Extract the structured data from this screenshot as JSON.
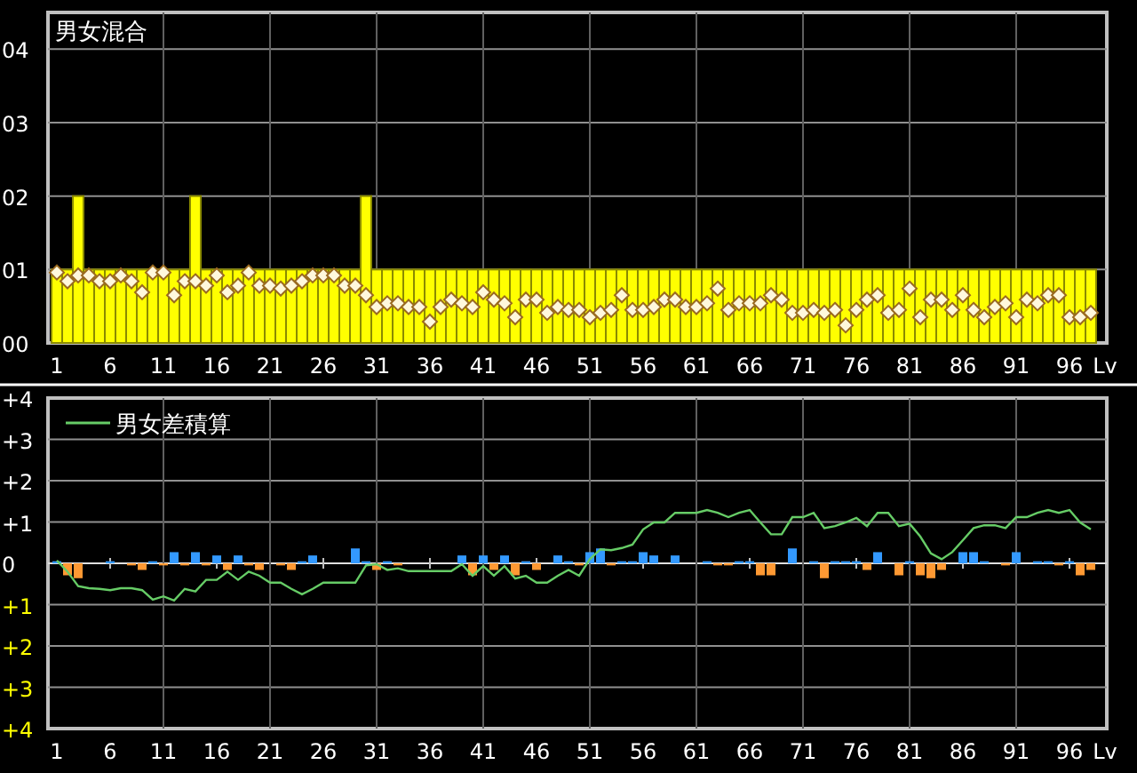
{
  "charts": [
    {
      "chart_data": {
        "type": "bar",
        "title": "男女混合",
        "xlabel": "Lv",
        "grid": true,
        "x": [
          1,
          2,
          3,
          4,
          5,
          6,
          7,
          8,
          9,
          10,
          11,
          12,
          13,
          14,
          15,
          16,
          17,
          18,
          19,
          20,
          21,
          22,
          23,
          24,
          25,
          26,
          27,
          28,
          29,
          30,
          31,
          32,
          33,
          34,
          35,
          36,
          37,
          38,
          39,
          40,
          41,
          42,
          43,
          44,
          45,
          46,
          47,
          48,
          49,
          50,
          51,
          52,
          53,
          54,
          55,
          56,
          57,
          58,
          59,
          60,
          61,
          62,
          63,
          64,
          65,
          66,
          67,
          68,
          69,
          70,
          71,
          72,
          73,
          74,
          75,
          76,
          77,
          78,
          79,
          80,
          81,
          82,
          83,
          84,
          85,
          86,
          87,
          88,
          89,
          90,
          91,
          92,
          93,
          94,
          95,
          96,
          97,
          98
        ],
        "xlim": [
          1,
          98
        ],
        "ylim": [
          0,
          4.5
        ],
        "xticks": [
          1,
          6,
          11,
          16,
          21,
          26,
          31,
          36,
          41,
          46,
          51,
          56,
          61,
          66,
          71,
          76,
          81,
          86,
          91,
          96
        ],
        "yticks": [
          {
            "value": 0,
            "label": "00"
          },
          {
            "value": 1,
            "label": "01"
          },
          {
            "value": 2,
            "label": "02"
          },
          {
            "value": 3,
            "label": "03"
          },
          {
            "value": 4,
            "label": "04"
          }
        ],
        "series": [
          {
            "color": "#ffff00",
            "values": [
              1,
              1,
              2,
              1,
              1,
              1,
              1,
              1,
              1,
              1,
              1,
              1,
              1,
              2,
              1,
              1,
              1,
              1,
              1,
              1,
              1,
              1,
              1,
              1,
              1,
              1,
              1,
              1,
              1,
              2,
              1,
              1,
              1,
              1,
              1,
              1,
              1,
              1,
              1,
              1,
              1,
              1,
              1,
              1,
              1,
              1,
              1,
              1,
              1,
              1,
              1,
              1,
              1,
              1,
              1,
              1,
              1,
              1,
              1,
              1,
              1,
              1,
              1,
              1,
              1,
              1,
              1,
              1,
              1,
              1,
              1,
              1,
              1,
              1,
              1,
              1,
              1,
              1,
              1,
              1,
              1,
              1,
              1,
              1,
              1,
              1,
              1,
              1,
              1,
              1,
              1,
              1,
              1,
              1,
              1,
              1,
              1,
              1
            ]
          },
          {
            "type": "scatter",
            "color": "#fff8dc",
            "values": [
              0.96,
              0.84,
              0.92,
              0.92,
              0.84,
              0.84,
              0.92,
              0.84,
              0.69,
              0.96,
              0.96,
              0.65,
              0.84,
              0.84,
              0.78,
              0.92,
              0.69,
              0.78,
              0.96,
              0.78,
              0.78,
              0.74,
              0.78,
              0.84,
              0.92,
              0.92,
              0.92,
              0.78,
              0.78,
              0.65,
              0.49,
              0.54,
              0.54,
              0.49,
              0.49,
              0.29,
              0.49,
              0.59,
              0.54,
              0.49,
              0.69,
              0.59,
              0.54,
              0.35,
              0.59,
              0.59,
              0.41,
              0.49,
              0.45,
              0.45,
              0.35,
              0.41,
              0.45,
              0.65,
              0.45,
              0.45,
              0.49,
              0.59,
              0.59,
              0.49,
              0.49,
              0.54,
              0.74,
              0.45,
              0.54,
              0.54,
              0.54,
              0.65,
              0.59,
              0.41,
              0.41,
              0.45,
              0.41,
              0.45,
              0.24,
              0.45,
              0.59,
              0.65,
              0.41,
              0.45,
              0.74,
              0.35,
              0.59,
              0.59,
              0.45,
              0.65,
              0.45,
              0.35,
              0.49,
              0.54,
              0.35,
              0.59,
              0.54,
              0.65,
              0.65,
              0.35,
              0.35,
              0.41
            ]
          }
        ]
      }
    },
    {
      "chart_data": {
        "type": "bar",
        "xlabel": "Lv",
        "grid": true,
        "x": [
          1,
          2,
          3,
          4,
          5,
          6,
          7,
          8,
          9,
          10,
          11,
          12,
          13,
          14,
          15,
          16,
          17,
          18,
          19,
          20,
          21,
          22,
          23,
          24,
          25,
          26,
          27,
          28,
          29,
          30,
          31,
          32,
          33,
          34,
          35,
          36,
          37,
          38,
          39,
          40,
          41,
          42,
          43,
          44,
          45,
          46,
          47,
          48,
          49,
          50,
          51,
          52,
          53,
          54,
          55,
          56,
          57,
          58,
          59,
          60,
          61,
          62,
          63,
          64,
          65,
          66,
          67,
          68,
          69,
          70,
          71,
          72,
          73,
          74,
          75,
          76,
          77,
          78,
          79,
          80,
          81,
          82,
          83,
          84,
          85,
          86,
          87,
          88,
          89,
          90,
          91,
          92,
          93,
          94,
          95,
          96,
          97,
          98
        ],
        "xlim": [
          1,
          98
        ],
        "ylim": [
          -4,
          4
        ],
        "xticks": [
          1,
          6,
          11,
          16,
          21,
          26,
          31,
          36,
          41,
          46,
          51,
          56,
          61,
          66,
          71,
          76,
          81,
          86,
          91,
          96
        ],
        "yticks": [
          {
            "value": 4,
            "label": "+4"
          },
          {
            "value": 3,
            "label": "+3"
          },
          {
            "value": 2,
            "label": "+2"
          },
          {
            "value": 1,
            "label": "+1"
          },
          {
            "value": 0,
            "label": "0"
          },
          {
            "value": -1,
            "label": "+1"
          },
          {
            "value": -2,
            "label": "+2"
          },
          {
            "value": -3,
            "label": "+3"
          },
          {
            "value": -4,
            "label": "+4"
          }
        ],
        "series": [
          {
            "color": "#3399ff",
            "values": [
              0.05,
              null,
              null,
              null,
              null,
              0.05,
              null,
              null,
              null,
              0.05,
              null,
              0.27,
              null,
              0.27,
              null,
              0.19,
              null,
              0.19,
              null,
              null,
              null,
              null,
              null,
              0.05,
              0.19,
              null,
              null,
              null,
              0.36,
              0.05,
              null,
              0.05,
              null,
              null,
              null,
              null,
              null,
              null,
              0.19,
              null,
              0.19,
              null,
              0.19,
              null,
              0.05,
              null,
              null,
              0.19,
              0.05,
              null,
              0.27,
              0.36,
              null,
              0.05,
              0.05,
              0.27,
              0.19,
              null,
              0.19,
              null,
              null,
              0.05,
              null,
              null,
              0.05,
              0.05,
              null,
              null,
              null,
              0.36,
              null,
              0.05,
              null,
              0.05,
              0.05,
              0.05,
              null,
              0.27,
              null,
              null,
              0.05,
              null,
              null,
              null,
              null,
              0.27,
              0.27,
              0.05,
              null,
              null,
              0.27,
              null,
              0.05,
              0.05,
              null,
              0.05,
              null,
              null
            ]
          },
          {
            "color": "#ff9933",
            "values": [
              null,
              -0.29,
              -0.36,
              null,
              null,
              null,
              null,
              -0.05,
              -0.16,
              null,
              -0.05,
              null,
              -0.05,
              null,
              -0.05,
              null,
              -0.16,
              null,
              -0.05,
              -0.16,
              null,
              -0.05,
              -0.16,
              null,
              null,
              null,
              null,
              null,
              null,
              null,
              -0.16,
              null,
              -0.05,
              null,
              null,
              null,
              null,
              null,
              null,
              -0.29,
              null,
              -0.16,
              null,
              -0.29,
              null,
              -0.16,
              null,
              null,
              null,
              -0.05,
              null,
              null,
              -0.05,
              null,
              null,
              null,
              null,
              null,
              null,
              null,
              null,
              null,
              -0.05,
              -0.05,
              null,
              null,
              -0.29,
              -0.29,
              null,
              null,
              null,
              null,
              -0.36,
              null,
              null,
              null,
              -0.16,
              null,
              null,
              -0.29,
              null,
              -0.29,
              -0.36,
              -0.16,
              null,
              null,
              null,
              null,
              null,
              -0.05,
              null,
              null,
              null,
              null,
              -0.05,
              null,
              -0.29,
              -0.16
            ]
          },
          {
            "type": "line",
            "name": "男女差積算",
            "color": "#66cc66",
            "values": [
              0.07,
              -0.2,
              -0.55,
              -0.6,
              -0.62,
              -0.65,
              -0.6,
              -0.6,
              -0.65,
              -0.88,
              -0.8,
              -0.9,
              -0.62,
              -0.68,
              -0.4,
              -0.4,
              -0.2,
              -0.4,
              -0.2,
              -0.3,
              -0.47,
              -0.47,
              -0.62,
              -0.75,
              -0.62,
              -0.47,
              -0.47,
              -0.47,
              -0.47,
              -0.05,
              -0.02,
              -0.16,
              -0.12,
              -0.19,
              -0.19,
              -0.19,
              -0.19,
              -0.19,
              -0.02,
              -0.3,
              -0.07,
              -0.3,
              -0.07,
              -0.37,
              -0.3,
              -0.47,
              -0.47,
              -0.3,
              -0.16,
              -0.3,
              0.1,
              0.34,
              0.32,
              0.37,
              0.45,
              0.82,
              0.99,
              0.99,
              1.22,
              1.22,
              1.22,
              1.29,
              1.22,
              1.12,
              1.22,
              1.29,
              0.99,
              0.7,
              0.7,
              1.12,
              1.12,
              1.22,
              0.85,
              0.9,
              0.99,
              1.1,
              0.9,
              1.22,
              1.22,
              0.9,
              0.96,
              0.65,
              0.24,
              0.1,
              0.27,
              0.56,
              0.85,
              0.92,
              0.92,
              0.85,
              1.12,
              1.12,
              1.22,
              1.29,
              1.22,
              1.29,
              0.99,
              0.82
            ]
          }
        ]
      }
    }
  ]
}
